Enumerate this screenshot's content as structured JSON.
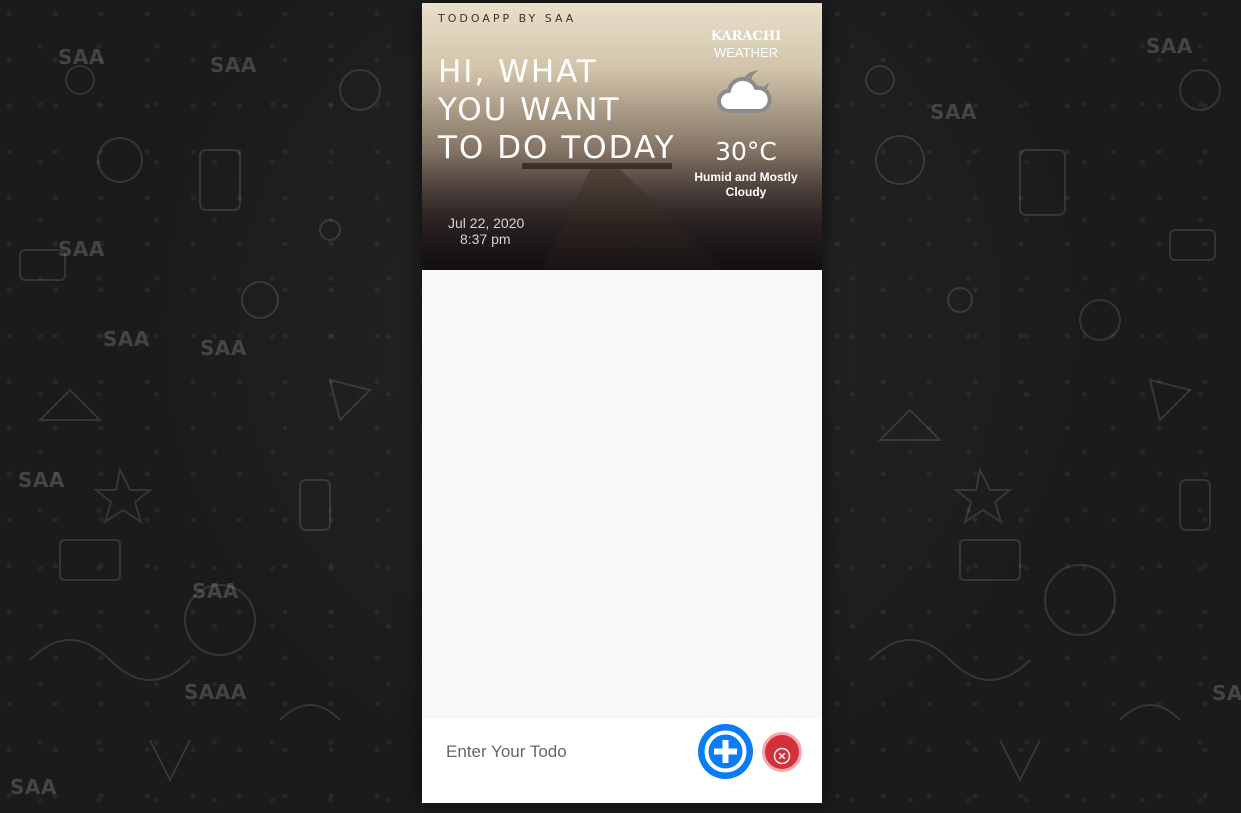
{
  "background": {
    "watermarks": [
      "SAA",
      "SAA",
      "SAA",
      "SAA",
      "SAA",
      "SAA",
      "SAA",
      "SAA",
      "SAAA",
      "SAA",
      "SAA",
      "SA"
    ]
  },
  "app": {
    "brand": "TODOAPP BY SAA",
    "headline": "HI, WHAT YOU WANT TO DO TODAY",
    "date": "Jul 22, 2020",
    "time": "8:37 pm",
    "weather": {
      "city": "KARACHI",
      "label": "WEATHER",
      "icon": "cloudy-night-icon",
      "temperature": "30°C",
      "description": "Humid and Mostly Cloudy"
    },
    "todos": [],
    "input": {
      "placeholder": "Enter Your Todo",
      "value": ""
    },
    "buttons": {
      "add_icon": "plus-circle-icon",
      "clear_icon": "close-circle-icon"
    }
  },
  "colors": {
    "add_button": "#0a7cf4",
    "clear_button": "#d3303a",
    "page_background": "#1b1b1b",
    "list_background": "#f7f8fa"
  }
}
